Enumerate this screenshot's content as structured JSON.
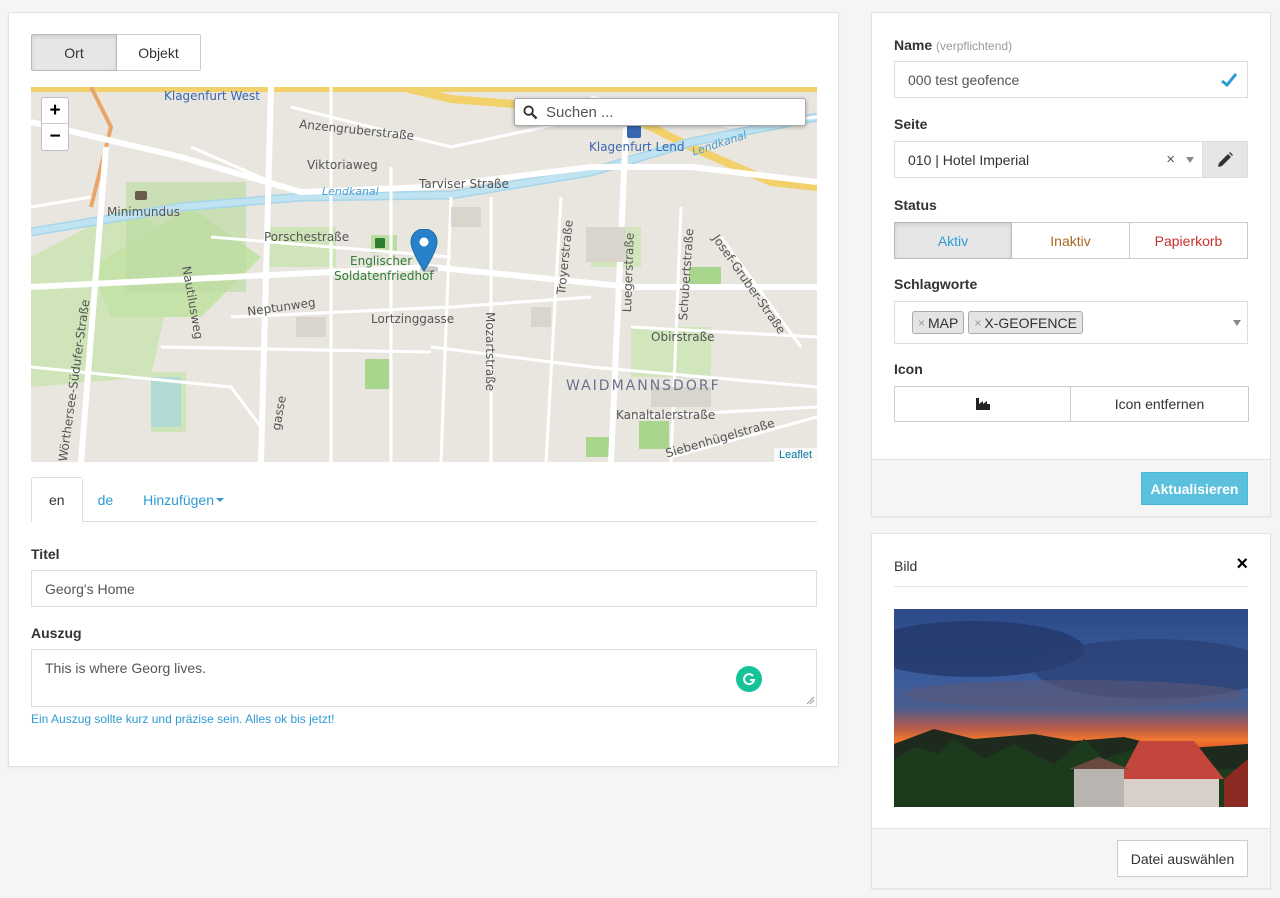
{
  "location_toggle": {
    "ort": "Ort",
    "objekt": "Objekt"
  },
  "map": {
    "search_placeholder": "Suchen ...",
    "zoom_in": "+",
    "zoom_out": "−",
    "attribution": "Leaflet",
    "labels": {
      "klagenfurt_west": "Klagenfurt West",
      "anzengruberstrasse": "Anzengruberstraße",
      "viktoriaweg": "Viktoriaweg",
      "klagenfurt_lend": "Klagenfurt Lend",
      "lendkanal_1": "Lendkanal",
      "lendkanal_2": "Lendkanal",
      "tarviser_strasse": "Tarviser Straße",
      "minimundus": "Minimundus",
      "porschestrasse": "Porschestraße",
      "englischer": "Englischer",
      "soldatenfriedhof": "Soldatenfriedhof",
      "nautilusweg": "Nautilusweg",
      "neptunweg": "Neptunweg",
      "lortzinggasse": "Lortzinggasse",
      "mozartstrasse": "Mozartstraße",
      "troyerstrasse": "Troyerstraße",
      "luegerstrasse": "Luegerstraße",
      "schubertstrasse": "Schubertstraße",
      "josef_gruber_strasse": "Josef-Gruber-Straße",
      "obirstrasse": "Obirstraße",
      "waidmannsdorf": "WAIDMANNSDORF",
      "kanaltalerstrasse": "Kanaltalerstraße",
      "siebenhuegelstrasse": "Siebenhügelstraße",
      "woerthersee_suedufer": "Wörthersee-Südufer-Straße",
      "gasse": "gasse"
    }
  },
  "language_tabs": {
    "en": "en",
    "de": "de",
    "add": "Hinzufügen"
  },
  "form": {
    "title_label": "Titel",
    "title_value": "Georg's Home",
    "excerpt_label": "Auszug",
    "excerpt_value": "This is where Georg lives.",
    "excerpt_hint": "Ein Auszug sollte kurz und präzise sein. Alles ok bis jetzt!"
  },
  "sidebar": {
    "name_label": "Name",
    "name_required": "(verpflichtend)",
    "name_value": "000 test geofence",
    "seite_label": "Seite",
    "seite_value": "010 | Hotel Imperial",
    "seite_clear": "×",
    "status_label": "Status",
    "status_options": [
      "Aktiv",
      "Inaktiv",
      "Papierkorb"
    ],
    "tags_label": "Schlagworte",
    "tags": [
      "MAP",
      "X-GEOFENCE"
    ],
    "tag_remove": "×",
    "icon_label": "Icon",
    "icon_remove": "Icon entfernen",
    "update_button": "Aktualisieren"
  },
  "image_panel": {
    "title": "Bild",
    "close": "×",
    "choose_file": "Datei auswählen"
  },
  "colors": {
    "accent": "#2e9bd2",
    "primary_button": "#5bc0de",
    "status_active": "#2e9bd2",
    "status_inactive": "#a66a1f",
    "status_trash": "#c9302c",
    "marker": "#2a81cb"
  }
}
